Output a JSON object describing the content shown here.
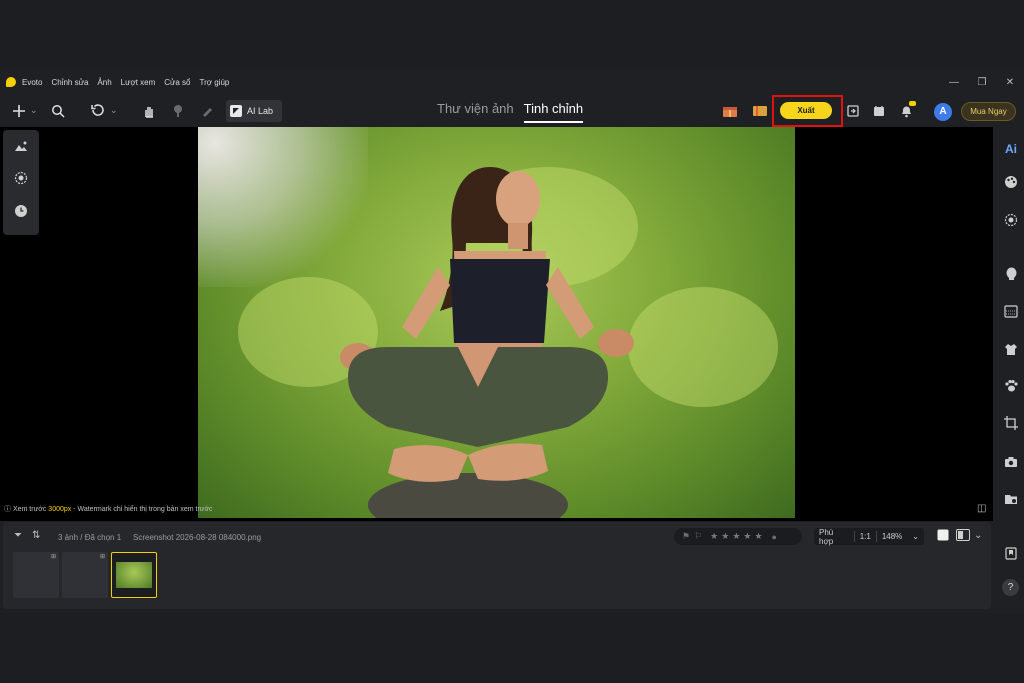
{
  "app": {
    "name": "Evoto",
    "menu": [
      "Chỉnh sửa",
      "Ảnh",
      "Lượt xem",
      "Cửa sổ",
      "Trợ giúp"
    ],
    "window_controls": [
      "—",
      "❐",
      "✕"
    ]
  },
  "toolbar": {
    "ai_lab_label": "AI Lab",
    "tabs": [
      {
        "label": "Thư viện ảnh",
        "active": false
      },
      {
        "label": "Tinh chỉnh",
        "active": true
      }
    ],
    "export_label": "Xuất",
    "avatar_letter": "A",
    "buy_label": "Mua Ngay",
    "accent_color": "#f7d51d",
    "highlight_color": "#e01212"
  },
  "canvas": {
    "preview_prefix": "Xem trước ",
    "preview_size": "3000px",
    "preview_suffix": " - Watermark chỉ hiển thị trong bản xem trước"
  },
  "filmstrip": {
    "count_label": "3 ảnh / Đã chọn 1",
    "filename": "Screenshot 2026-08-28 084000.png",
    "rating_flags": [
      "⚑",
      "⚐"
    ],
    "stars": [
      "★",
      "★",
      "★",
      "★",
      "★"
    ],
    "fit_label": "Phù hợp",
    "ratio_label": "1:1",
    "zoom_label": "148%"
  },
  "icons": {
    "add": "add-icon",
    "search": "search-icon",
    "undo": "undo-icon",
    "hand": "hand-icon",
    "ai": "ai-icon",
    "help": "?"
  }
}
